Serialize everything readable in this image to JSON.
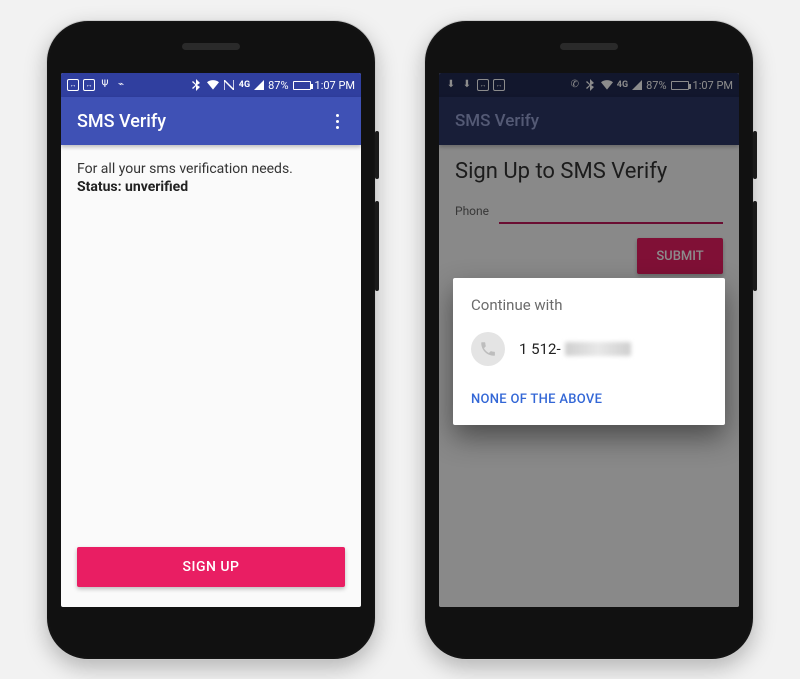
{
  "statusbar": {
    "battery_pct": "87%",
    "battery_fill_pct": 87,
    "clock": "1:07 PM"
  },
  "left": {
    "appbar_title": "SMS Verify",
    "tagline": "For all your sms verification needs.",
    "status_line": "Status: unverified",
    "signup_button": "SIGN UP"
  },
  "right": {
    "appbar_title": "SMS Verify",
    "heading": "Sign Up to SMS Verify",
    "phone_label": "Phone",
    "phone_value": "",
    "submit_button": "SUBMIT",
    "dialog": {
      "title": "Continue with",
      "phone_visible_prefix": "1 512-",
      "none_action": "NONE OF THE ABOVE"
    }
  }
}
